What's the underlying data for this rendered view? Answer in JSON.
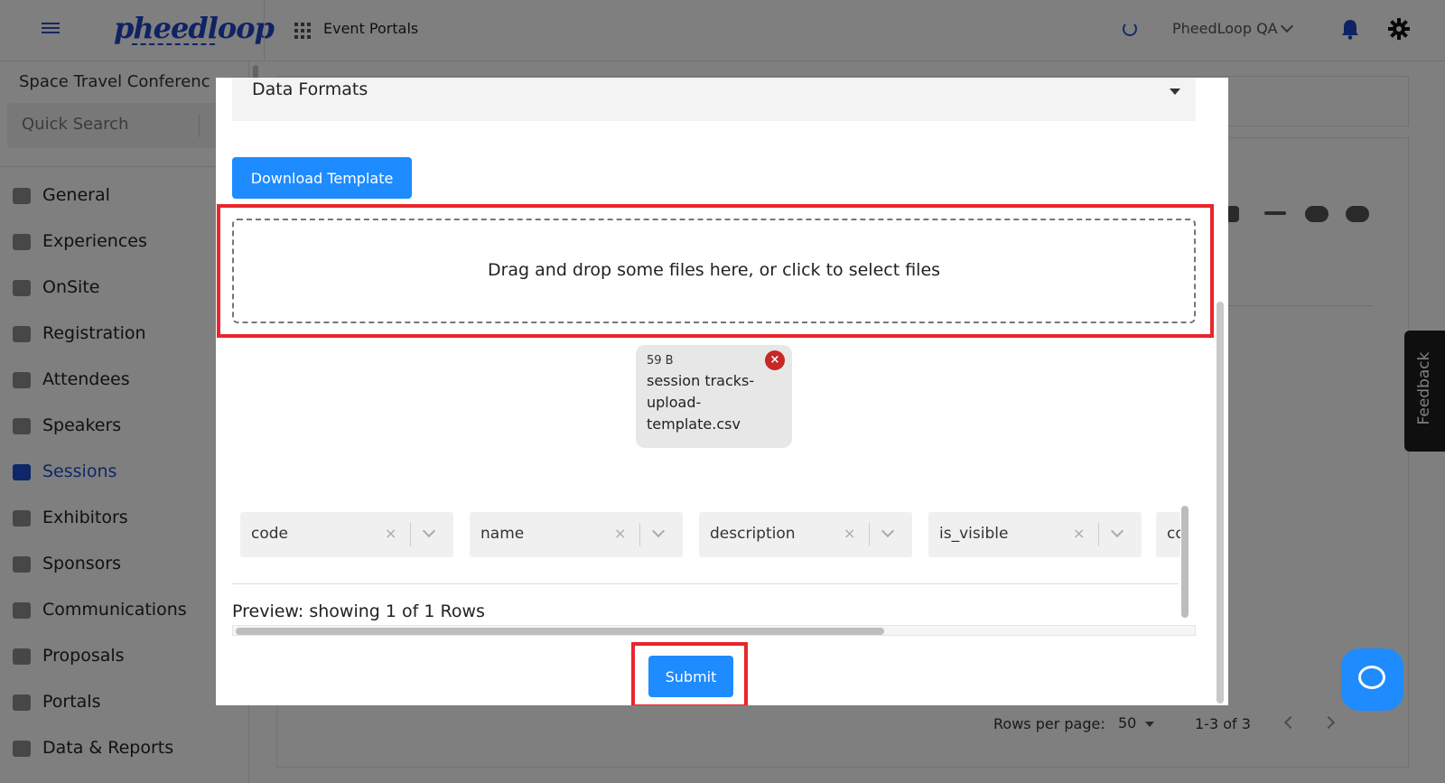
{
  "header": {
    "logo_text": "pheedloop",
    "app_switcher_label": "Event Portals",
    "account_name": "PheedLoop QA"
  },
  "sidebar": {
    "event_name": "Space Travel Conferenc",
    "quick_search_placeholder": "Quick Search",
    "items": [
      {
        "label": "General",
        "icon": "grid-icon"
      },
      {
        "label": "Experiences",
        "icon": "person-icon"
      },
      {
        "label": "OnSite",
        "icon": "printer-icon"
      },
      {
        "label": "Registration",
        "icon": "cart-icon"
      },
      {
        "label": "Attendees",
        "icon": "people-icon"
      },
      {
        "label": "Speakers",
        "icon": "speaker-icon"
      },
      {
        "label": "Sessions",
        "icon": "laptop-icon",
        "active": true
      },
      {
        "label": "Exhibitors",
        "icon": "store-icon"
      },
      {
        "label": "Sponsors",
        "icon": "briefcase-icon"
      },
      {
        "label": "Communications",
        "icon": "mail-icon"
      },
      {
        "label": "Proposals",
        "icon": "document-icon"
      },
      {
        "label": "Portals",
        "icon": "globe-icon"
      },
      {
        "label": "Data & Reports",
        "icon": "chart-icon"
      }
    ]
  },
  "table_footer": {
    "rows_per_page_label": "Rows per page:",
    "rows_per_page_value": "50",
    "page_range": "1-3 of 3"
  },
  "feedback_label": "Feedback",
  "modal": {
    "data_formats_label": "Data Formats",
    "download_template_label": "Download Template",
    "dropzone_text": "Drag and drop some files here, or click to select files",
    "file": {
      "size": "59 B",
      "name": "session tracks-upload-template.csv",
      "remove_symbol": "×"
    },
    "column_mappings": [
      {
        "label": "code"
      },
      {
        "label": "name"
      },
      {
        "label": "description"
      },
      {
        "label": "is_visible"
      },
      {
        "label": "co"
      }
    ],
    "clear_symbol": "×",
    "preview_text": "Preview: showing 1 of 1 Rows",
    "submit_label": "Submit"
  },
  "colors": {
    "accent": "#1e8bff",
    "brand": "#1e46c8",
    "highlight": "#e8262b",
    "remove": "#c62828"
  }
}
